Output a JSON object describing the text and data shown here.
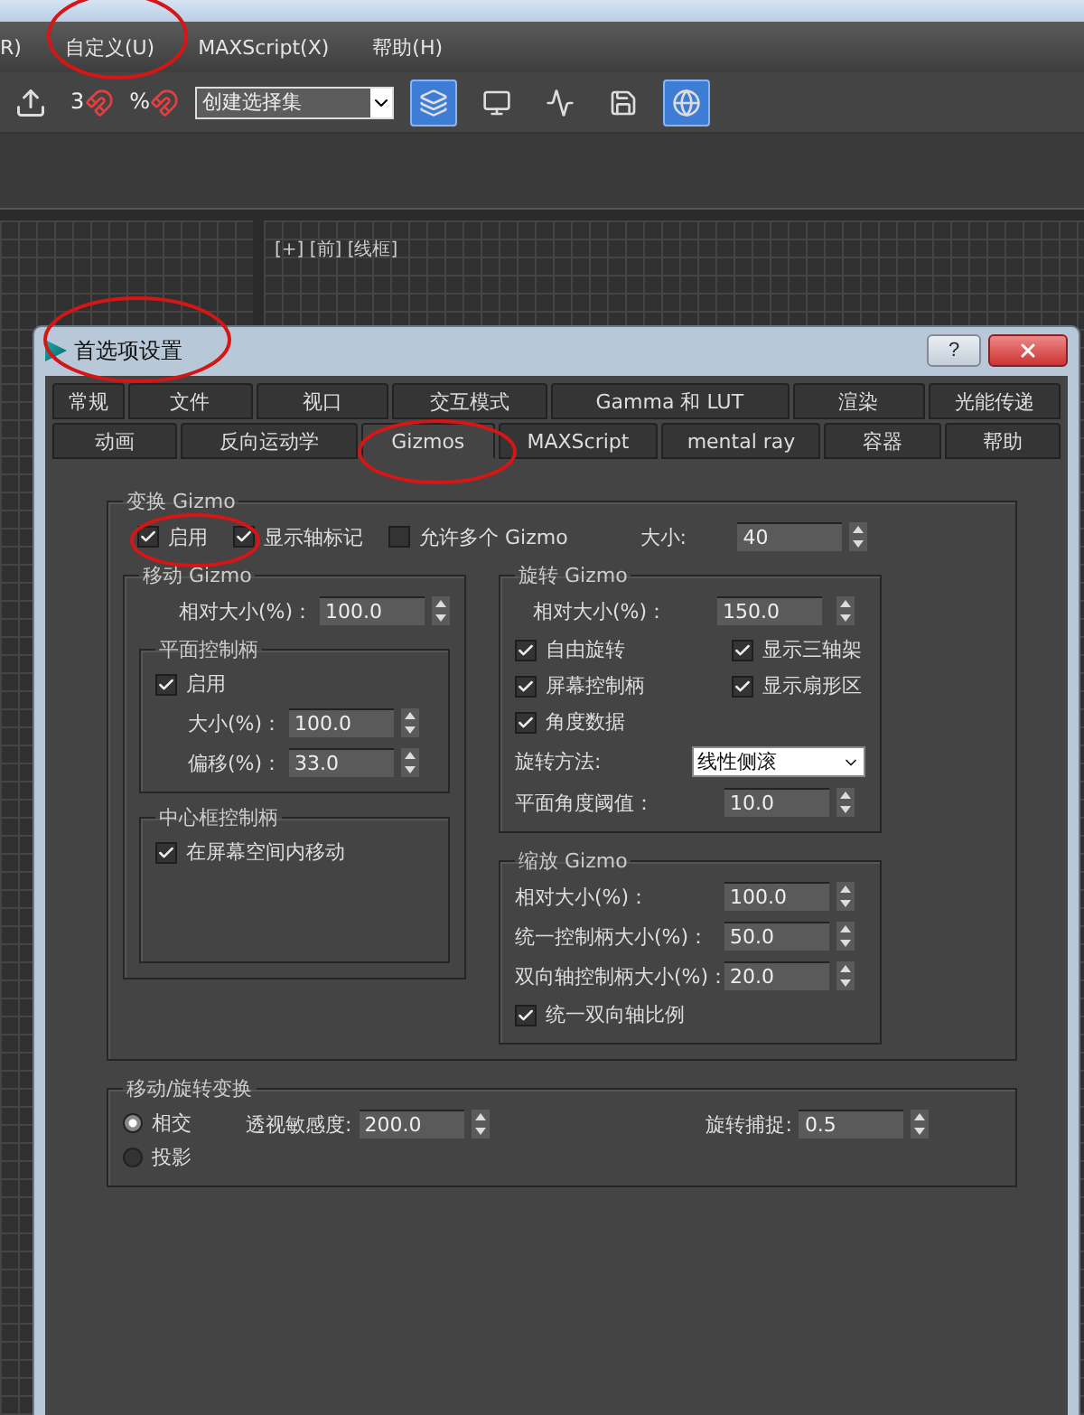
{
  "menu": [
    {
      "label": "R)"
    },
    {
      "label": "自定义(U)"
    },
    {
      "label": "MAXScript(X)"
    },
    {
      "label": "帮助(H)"
    }
  ],
  "toolbar": {
    "snap_labels": [
      "3",
      "%"
    ],
    "selection_set": "创建选择集",
    "pressed": [
      true,
      false,
      false,
      false,
      true
    ]
  },
  "viewport": {
    "label": "[+] [前] [线框]"
  },
  "dialog": {
    "title": "首选项设置",
    "help": "?",
    "tab_rows": [
      [
        {
          "label": "常规",
          "selected": false
        },
        {
          "label": "文件",
          "selected": false
        },
        {
          "label": "视口",
          "selected": false
        },
        {
          "label": "交互模式",
          "selected": false
        },
        {
          "label": "Gamma 和 LUT",
          "selected": false
        },
        {
          "label": "渲染",
          "selected": false
        },
        {
          "label": "光能传递",
          "selected": false
        }
      ],
      [
        {
          "label": "动画",
          "selected": false
        },
        {
          "label": "反向运动学",
          "selected": false
        },
        {
          "label": "Gizmos",
          "selected": true
        },
        {
          "label": "MAXScript",
          "selected": false
        },
        {
          "label": "mental ray",
          "selected": false
        },
        {
          "label": "容器",
          "selected": false
        },
        {
          "label": "帮助",
          "selected": false
        }
      ]
    ],
    "transform_gizmo": {
      "title": "变换 Gizmo",
      "checks": [
        {
          "label": "启用",
          "checked": true
        },
        {
          "label": "显示轴标记",
          "checked": true
        },
        {
          "label": "允许多个 Gizmo",
          "checked": false
        }
      ],
      "size": {
        "label": "大小:",
        "value": "40"
      }
    },
    "move_gizmo": {
      "title": "移动 Gizmo",
      "relative_size": {
        "label": "相对大小(%)：",
        "value": "100.0"
      },
      "plane_handles": {
        "title": "平面控制柄",
        "enable": {
          "label": "启用",
          "checked": true
        },
        "size": {
          "label": "大小(%)：",
          "value": "100.0"
        },
        "offset": {
          "label": "偏移(%)：",
          "value": "33.0"
        }
      },
      "center_box": {
        "title": "中心框控制柄",
        "check": {
          "label": "在屏幕空间内移动",
          "checked": true
        }
      }
    },
    "rotate_gizmo": {
      "title": "旋转 Gizmo",
      "relative_size": {
        "label": "相对大小(%)：",
        "value": "150.0"
      },
      "checks": [
        {
          "label": "自由旋转",
          "checked": true
        },
        {
          "label": "显示三轴架",
          "checked": true
        },
        {
          "label": "屏幕控制柄",
          "checked": true
        },
        {
          "label": "显示扇形区",
          "checked": true
        },
        {
          "label": "角度数据",
          "checked": true
        }
      ],
      "method": {
        "label": "旋转方法:",
        "value": "线性侧滚"
      },
      "plane_angle": {
        "label": "平面角度阈值：",
        "value": "10.0"
      }
    },
    "scale_gizmo": {
      "title": "缩放 Gizmo",
      "fields": [
        {
          "label": "相对大小(%)：",
          "value": "100.0"
        },
        {
          "label": "统一控制柄大小(%)：",
          "value": "50.0"
        },
        {
          "label": "双向轴控制柄大小(%)：",
          "value": "20.0"
        }
      ],
      "uniform": {
        "label": "统一双向轴比例",
        "checked": true
      }
    },
    "move_rotate": {
      "title": "移动/旋转变换",
      "radios": [
        {
          "label": "相交",
          "selected": true
        },
        {
          "label": "投影",
          "selected": false
        }
      ],
      "perspective": {
        "label": "透视敏感度:",
        "value": "200.0"
      },
      "rotate_snap": {
        "label": "旋转捕捉:",
        "value": "0.5"
      }
    }
  }
}
